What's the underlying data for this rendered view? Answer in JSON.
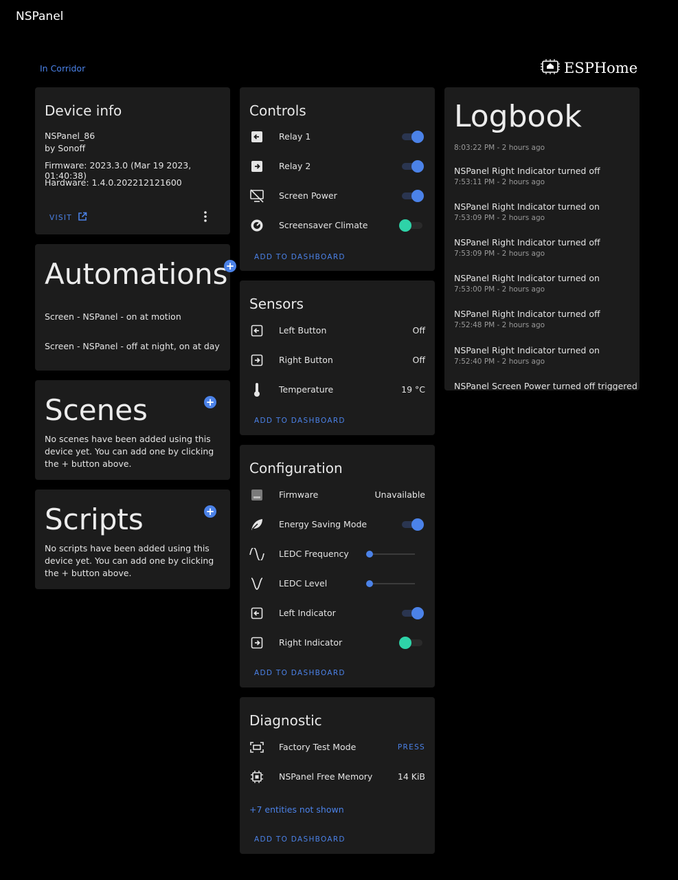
{
  "app": {
    "title": "NSPanel",
    "area": "In Corridor",
    "brand": "ESPHome"
  },
  "device_info": {
    "title": "Device info",
    "model": "NSPanel_86",
    "manufacturer": "by Sonoff",
    "firmware": "Firmware: 2023.3.0 (Mar 19 2023, 01:40:38)",
    "hardware": "Hardware: 1.4.0.202212121600",
    "visit_label": "VISIT"
  },
  "automations": {
    "title": "Automations",
    "items": [
      "Screen - NSPanel - on at motion",
      "Screen - NSPanel - off at night, on at day"
    ]
  },
  "scenes": {
    "title": "Scenes",
    "empty_text": "No scenes have been added using this device yet. You can add one by clicking the + button above."
  },
  "scripts": {
    "title": "Scripts",
    "empty_text": "No scripts have been added using this device yet. You can add one by clicking the + button above."
  },
  "controls": {
    "title": "Controls",
    "items": [
      {
        "label": "Relay 1",
        "state": "on",
        "icon": "arrow-left-box-icon"
      },
      {
        "label": "Relay 2",
        "state": "on",
        "icon": "arrow-right-box-icon"
      },
      {
        "label": "Screen Power",
        "state": "on",
        "icon": "monitor-off-icon"
      },
      {
        "label": "Screensaver Climate",
        "state": "off",
        "icon": "gauge-icon"
      }
    ],
    "add_label": "ADD TO DASHBOARD"
  },
  "sensors": {
    "title": "Sensors",
    "items": [
      {
        "label": "Left Button",
        "value": "Off",
        "icon": "arrow-left-box-icon"
      },
      {
        "label": "Right Button",
        "value": "Off",
        "icon": "arrow-right-box-icon"
      },
      {
        "label": "Temperature",
        "value": "19 °C",
        "icon": "thermometer-icon"
      }
    ],
    "add_label": "ADD TO DASHBOARD"
  },
  "configuration": {
    "title": "Configuration",
    "items": [
      {
        "label": "Firmware",
        "value": "Unavailable",
        "icon": "package-icon"
      },
      {
        "label": "Energy Saving Mode",
        "state": "on",
        "icon": "leaf-icon"
      },
      {
        "label": "LEDC Frequency",
        "slider": 0.0,
        "icon": "sine-wave-icon"
      },
      {
        "label": "LEDC Level",
        "slider": 0.0,
        "icon": "v-wave-icon"
      },
      {
        "label": "Left Indicator",
        "state": "on",
        "icon": "arrow-left-box-icon"
      },
      {
        "label": "Right Indicator",
        "state": "off",
        "icon": "arrow-right-box-icon"
      }
    ],
    "add_label": "ADD TO DASHBOARD"
  },
  "diagnostic": {
    "title": "Diagnostic",
    "items": [
      {
        "label": "Factory Test Mode",
        "action": "PRESS",
        "icon": "scan-icon"
      },
      {
        "label": "NSPanel Free Memory",
        "value": "14 KiB",
        "icon": "chip-icon"
      }
    ],
    "hidden_entities": "+7 entities not shown",
    "add_label": "ADD TO DASHBOARD"
  },
  "logbook": {
    "title": "Logbook",
    "first_time": "8:03:22 PM - 2 hours ago",
    "entries": [
      {
        "message": "NSPanel Right Indicator turned off",
        "time": "7:53:11 PM - 2 hours ago"
      },
      {
        "message": "NSPanel Right Indicator turned on",
        "time": "7:53:09 PM - 2 hours ago"
      },
      {
        "message": "NSPanel Right Indicator turned off",
        "time": "7:53:09 PM - 2 hours ago"
      },
      {
        "message": "NSPanel Right Indicator turned on",
        "time": "7:53:00 PM - 2 hours ago"
      },
      {
        "message": "NSPanel Right Indicator turned off",
        "time": "7:52:48 PM - 2 hours ago"
      },
      {
        "message": "NSPanel Right Indicator turned on",
        "time": "7:52:40 PM - 2 hours ago"
      },
      {
        "message": "NSPanel Screen Power turned off triggered by",
        "time": ""
      }
    ]
  },
  "colors": {
    "accent": "#4b82e8",
    "toggle_off": "#2ed3a8",
    "card": "#1c1c1c",
    "background": "#000000"
  }
}
